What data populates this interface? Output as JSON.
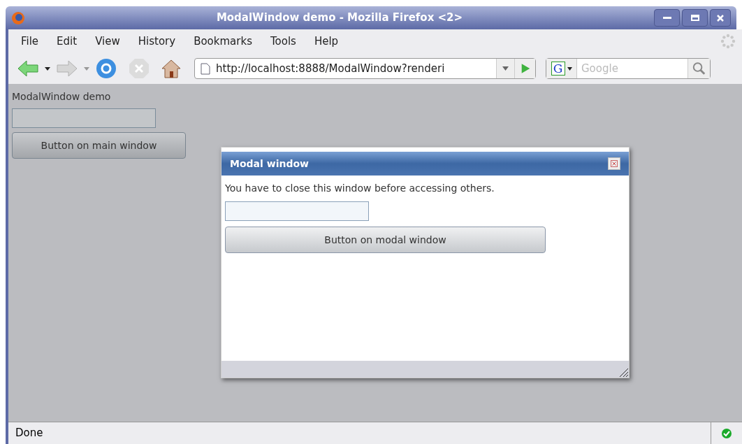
{
  "window": {
    "title": "ModalWindow demo - Mozilla Firefox <2>"
  },
  "menu": [
    {
      "label": "File"
    },
    {
      "label": "Edit"
    },
    {
      "label": "View"
    },
    {
      "label": "History"
    },
    {
      "label": "Bookmarks"
    },
    {
      "label": "Tools"
    },
    {
      "label": "Help"
    }
  ],
  "address": {
    "value": "http://localhost:8888/ModalWindow?renderi"
  },
  "search": {
    "engine": "G",
    "placeholder": "Google"
  },
  "page": {
    "heading": "ModalWindow demo",
    "button": "Button on main window"
  },
  "modal": {
    "title": "Modal window",
    "message": "You have to close this window before accessing others.",
    "button": "Button on modal window"
  },
  "status_bar": {
    "text": "Done"
  }
}
